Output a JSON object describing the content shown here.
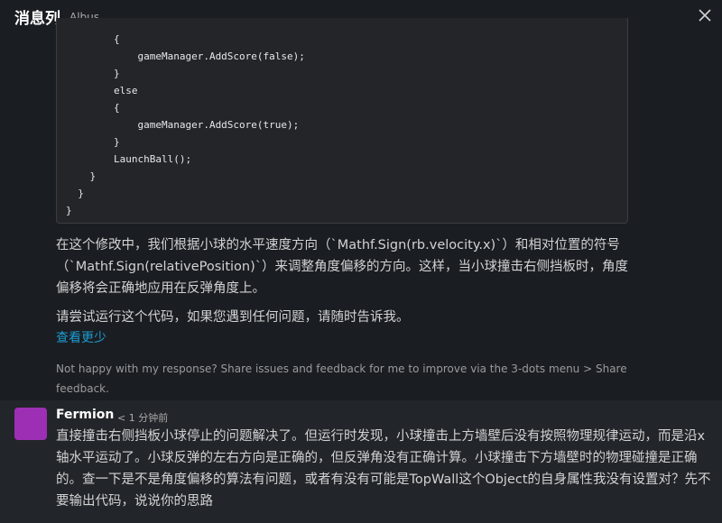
{
  "header": {
    "title": "消息列",
    "subtitle": "Albus"
  },
  "code_lines": [
    "        {",
    "            gameManager.AddScore(false);",
    "        }",
    "        else",
    "        {",
    "            gameManager.AddScore(true);",
    "        }",
    "        LaunchBall();",
    "    }",
    "  }",
    "}"
  ],
  "assistant": {
    "para1": "在这个修改中，我们根据小球的水平速度方向（`Mathf.Sign(rb.velocity.x)`）和相对位置的符号（`Mathf.Sign(relativePosition)`）来调整角度偏移的方向。这样，当小球撞击右侧挡板时，角度偏移将会正确地应用在反弹角度上。",
    "para2": "请尝试运行这个代码，如果您遇到任何问题，请随时告诉我。",
    "see_more": "查看更少",
    "feedback": "Not happy with my response? Share issues and feedback for me to improve via the 3-dots menu > Share feedback."
  },
  "user_message": {
    "sender": "Fermion",
    "time": "< 1 分钟前",
    "text": "直接撞击右侧挡板小球停止的问题解决了。但运行时发现，小球撞击上方墙壁后没有按照物理规律运动，而是沿x轴水平运动了。小球反弹的左右方向是正确的，但反弹角没有正确计算。小球撞击下方墙壁时的物理碰撞是正确的。查一下是不是角度偏移的算法有问题，或者有没有可能是TopWall这个Object的自身属性我没有设置对？先不要输出代码，说说你的思路",
    "avatar_color": "#9c2fb4"
  },
  "colors": {
    "link": "#1d9bd1",
    "background": "#1a1d21"
  }
}
